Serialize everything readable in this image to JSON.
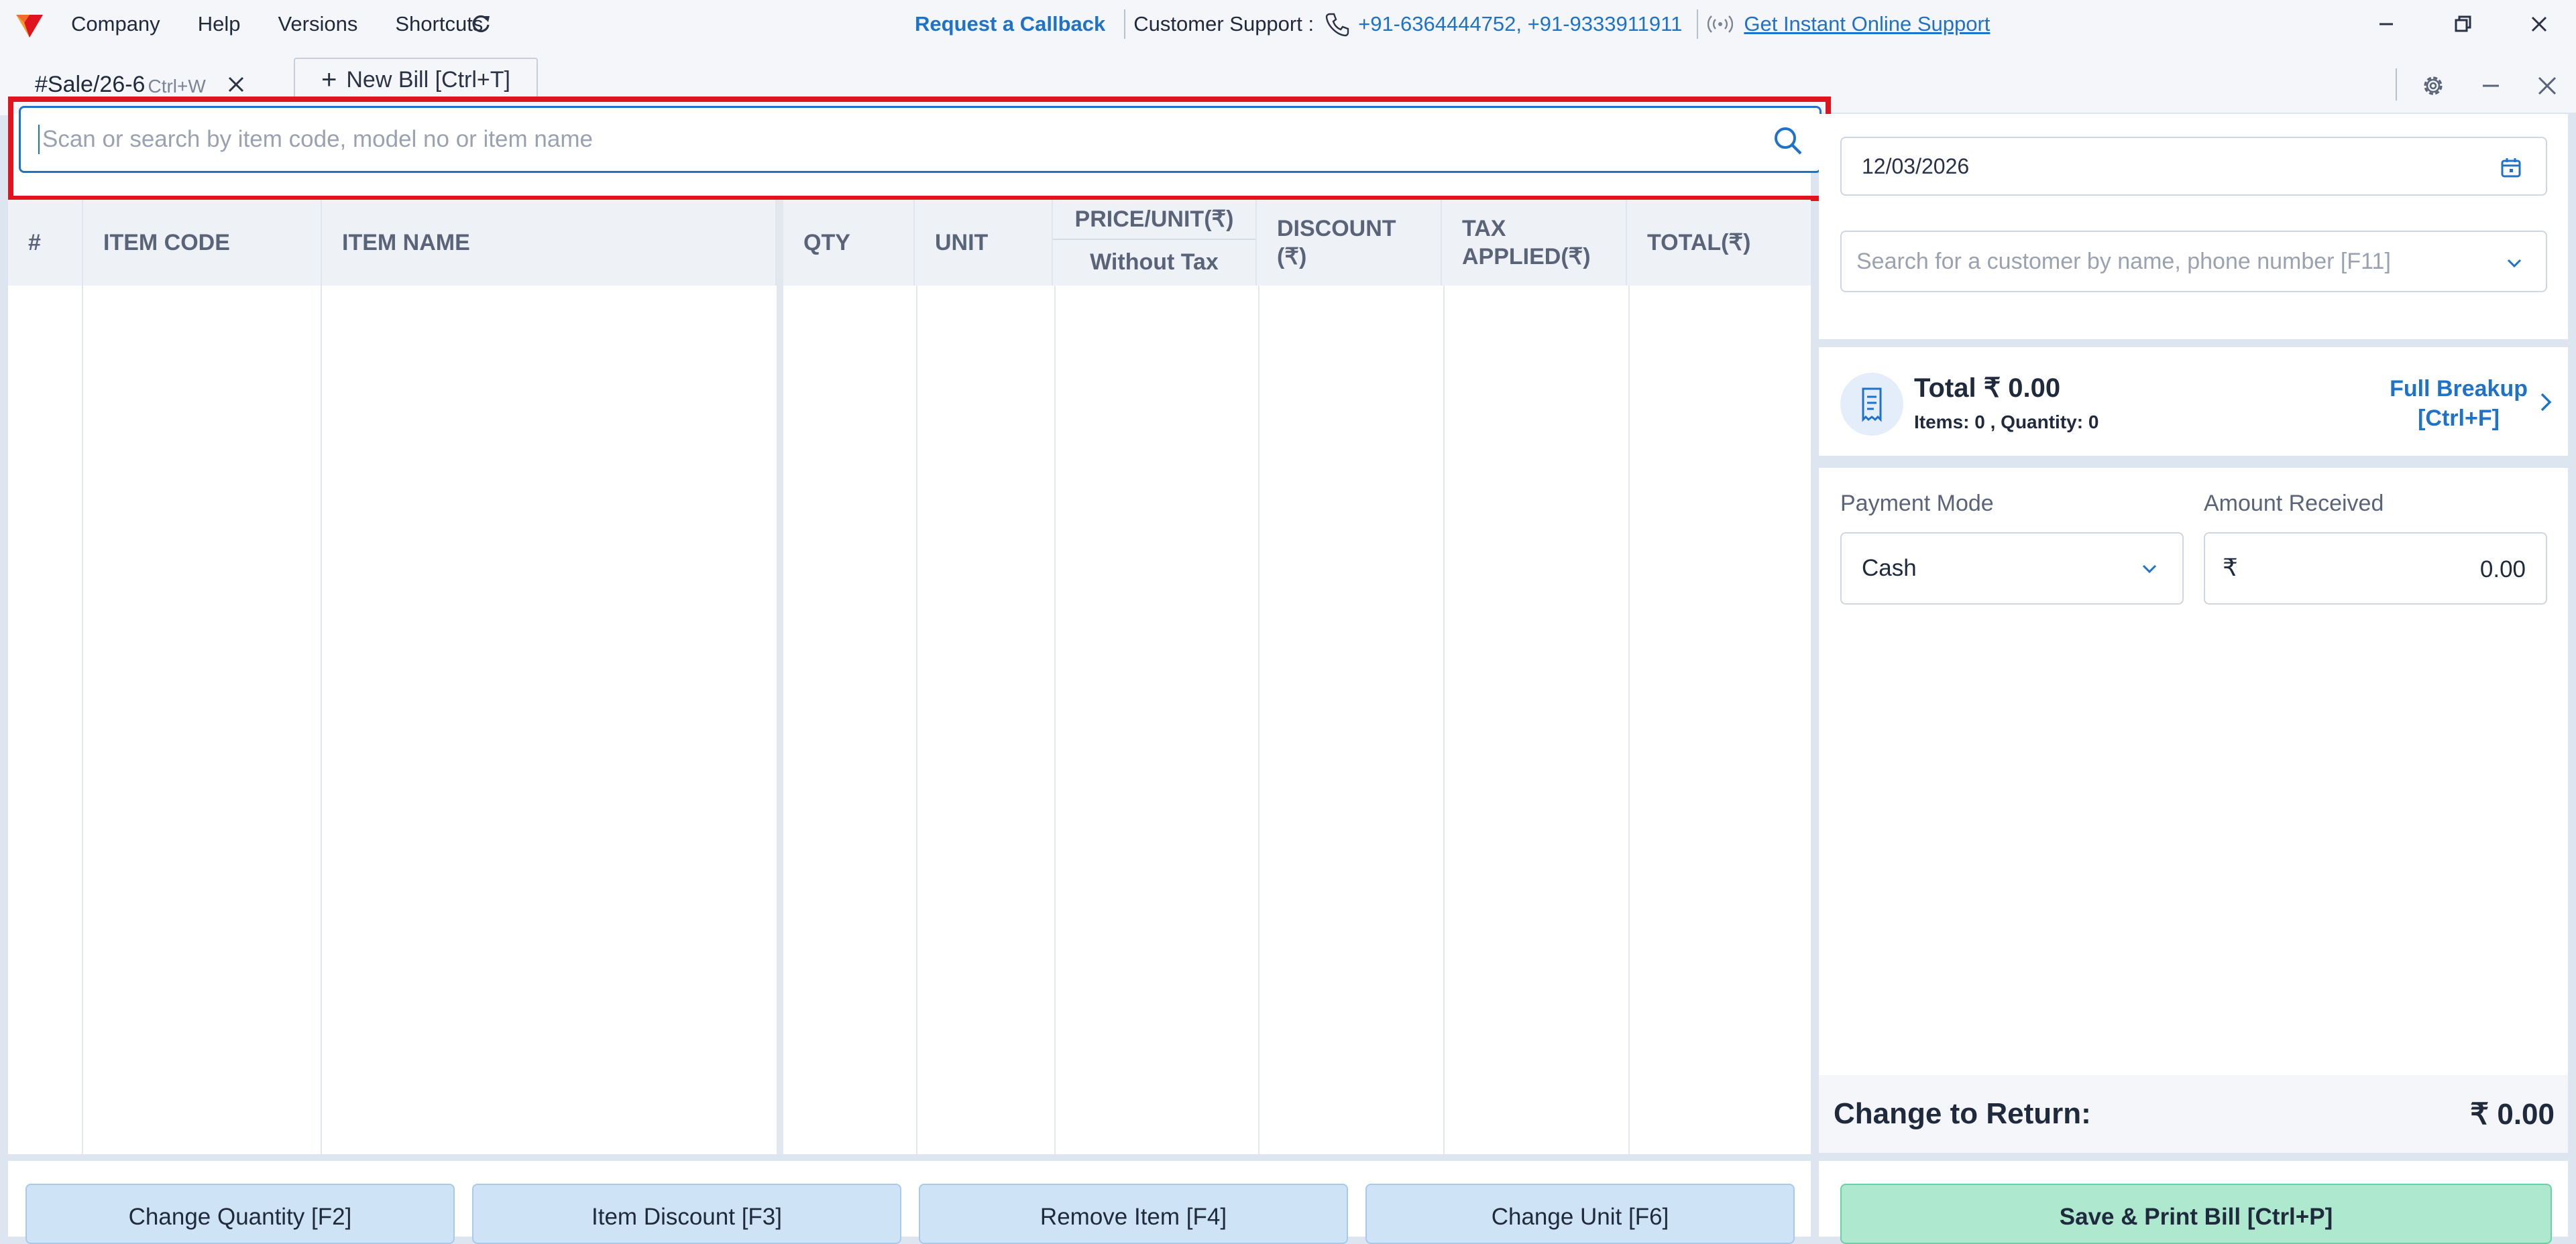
{
  "menu": {
    "items": [
      "Company",
      "Help",
      "Versions",
      "Shortcuts"
    ]
  },
  "support": {
    "callback": "Request a Callback",
    "label": "Customer Support :",
    "phones": "+91-6364444752, +91-9333911911",
    "online": "Get Instant Online Support"
  },
  "tabs": {
    "active_title": "#Sale/26-6",
    "active_shortcut": "Ctrl+W",
    "new_bill": "New Bill [Ctrl+T]"
  },
  "search": {
    "placeholder": "Scan or search by item code, model no or item name"
  },
  "table": {
    "headers": {
      "num": "#",
      "item_code": "ITEM CODE",
      "item_name": "ITEM NAME",
      "qty": "QTY",
      "unit": "UNIT",
      "price_top": "PRICE/UNIT(₹)",
      "price_bottom": "Without Tax",
      "discount_1": "DISCOUNT",
      "discount_2": "(₹)",
      "tax_1": "TAX",
      "tax_2": "APPLIED(₹)",
      "total": "TOTAL(₹)"
    }
  },
  "actions": {
    "change_qty": "Change Quantity [F2]",
    "item_discount": "Item Discount [F3]",
    "remove_item": "Remove Item [F4]",
    "change_unit": "Change Unit [F6]"
  },
  "right": {
    "date": "12/03/2026",
    "customer_placeholder": "Search for a customer by name, phone number [F11]",
    "total_title": "Total ₹ 0.00",
    "total_sub": "Items: 0 , Quantity: 0",
    "breakup_1": "Full Breakup",
    "breakup_2": "[Ctrl+F]",
    "payment_mode_label": "Payment Mode",
    "payment_mode": "Cash",
    "amount_label": "Amount Received",
    "currency": "₹",
    "amount": "0.00",
    "change_label": "Change to Return:",
    "change_value": "₹ 0.00",
    "save": "Save & Print Bill [Ctrl+P]"
  },
  "colors": {
    "accent": "#1e73c9",
    "highlight_frame": "#e0141e",
    "action_button": "#cfe3f7",
    "save_button": "#aee8cf"
  }
}
